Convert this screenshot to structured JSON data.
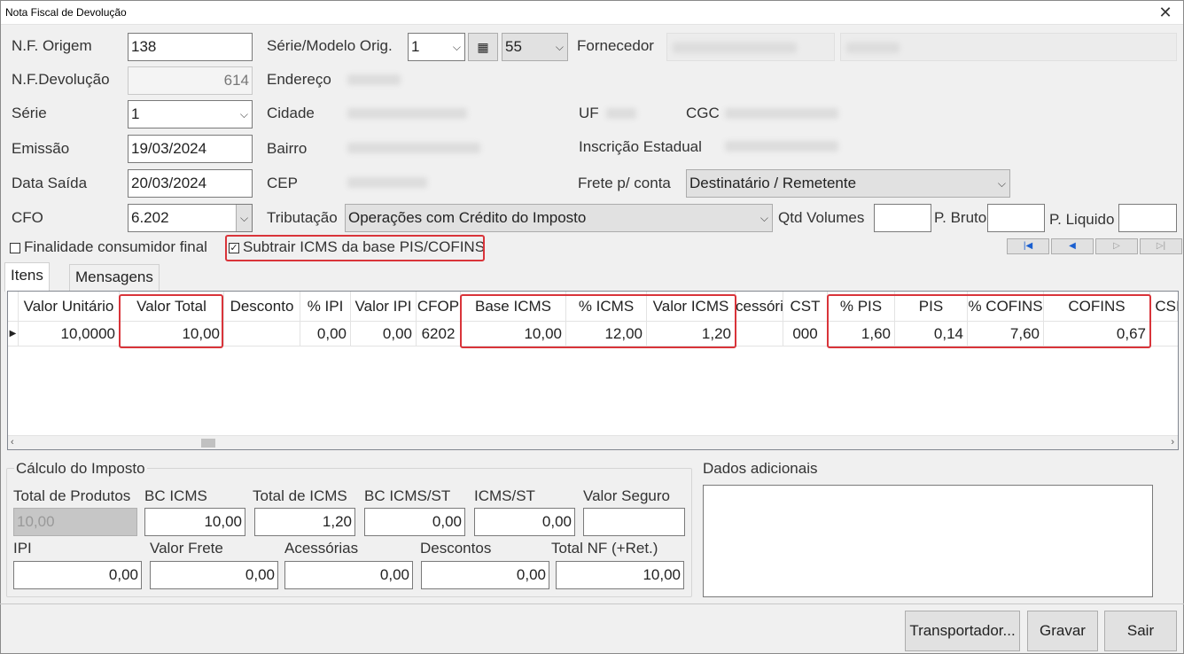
{
  "window": {
    "title": "Nota Fiscal de Devolução",
    "close_glyph": "✕"
  },
  "header": {
    "nf_origem_label": "N.F. Origem",
    "nf_origem_value": "138",
    "nf_devolucao_label": "N.F.Devolução",
    "nf_devolucao_value": "614",
    "serie_label": "Série",
    "serie_value": "1",
    "emissao_label": "Emissão",
    "emissao_value": "19/03/2024",
    "data_saida_label": "Data Saída",
    "data_saida_value": "20/03/2024",
    "cfo_label": "CFO",
    "cfo_value": "6.202",
    "serie_modelo_label": "Série/Modelo Orig.",
    "serie_orig_value": "1",
    "modelo_orig_value": "55",
    "fornecedor_label": "Fornecedor",
    "endereco_label": "Endereço",
    "cidade_label": "Cidade",
    "bairro_label": "Bairro",
    "cep_label": "CEP",
    "uf_label": "UF",
    "cgc_label": "CGC",
    "inscricao_label": "Inscrição Estadual",
    "frete_label": "Frete p/ conta",
    "frete_value": "Destinatário / Remetente",
    "tributacao_label": "Tributação",
    "tributacao_value": "Operações com Crédito do Imposto",
    "qtd_volumes_label": "Qtd Volumes",
    "p_bruto_label": "P. Bruto",
    "p_liquido_label": "P. Liquido",
    "finalidade_label": "Finalidade consumidor final",
    "finalidade_checked": false,
    "subtrair_label": "Subtrair ICMS da base PIS/COFINS",
    "subtrair_checked": true
  },
  "tabs": {
    "itens": "Itens",
    "mensagens": "Mensagens"
  },
  "grid": {
    "columns": [
      "Valor Unitário",
      "Valor Total",
      "Desconto",
      "% IPI",
      "Valor IPI",
      "CFOP",
      "Base ICMS",
      "% ICMS",
      "Valor ICMS",
      "cessóri",
      "CST",
      "% PIS",
      "PIS",
      "% COFINS",
      "COFINS",
      "CSI"
    ],
    "rows": [
      [
        "10,0000",
        "10,00",
        "",
        "0,00",
        "0,00",
        "6202",
        "10,00",
        "12,00",
        "1,20",
        "",
        "000",
        "1,60",
        "0,14",
        "7,60",
        "0,67",
        ""
      ]
    ]
  },
  "calculo": {
    "title": "Cálculo do Imposto",
    "total_produtos_label": "Total de Produtos",
    "total_produtos_value": "10,00",
    "bc_icms_label": "BC ICMS",
    "bc_icms_value": "10,00",
    "total_icms_label": "Total de ICMS",
    "total_icms_value": "1,20",
    "bc_icms_st_label": "BC ICMS/ST",
    "bc_icms_st_value": "0,00",
    "icms_st_label": "ICMS/ST",
    "icms_st_value": "0,00",
    "valor_seguro_label": "Valor Seguro",
    "valor_seguro_value": "",
    "ipi_label": "IPI",
    "ipi_value": "0,00",
    "valor_frete_label": "Valor Frete",
    "valor_frete_value": "0,00",
    "acessorias_label": "Acessórias",
    "acessorias_value": "0,00",
    "descontos_label": "Descontos",
    "descontos_value": "0,00",
    "total_nf_label": "Total NF (+Ret.)",
    "total_nf_value": "10,00"
  },
  "dados_adicionais": {
    "title": "Dados adicionais"
  },
  "buttons": {
    "transportador": "Transportador...",
    "gravar": "Gravar",
    "sair": "Sair"
  },
  "colors": {
    "highlight": "#d9343a",
    "nav_blue": "#1a5fd0"
  }
}
